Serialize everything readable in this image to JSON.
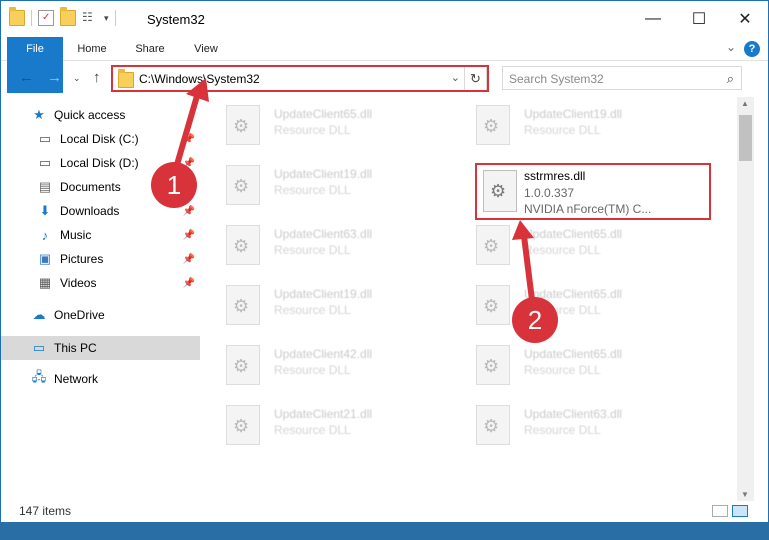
{
  "window": {
    "title": "System32"
  },
  "ribbon": {
    "tabs": [
      "File",
      "Home",
      "Share",
      "View"
    ],
    "help": "?"
  },
  "address": {
    "path": "C:\\Windows\\System32"
  },
  "search": {
    "placeholder": "Search System32"
  },
  "sidebar": {
    "items": [
      {
        "label": "Quick access",
        "icon": "star-icon"
      },
      {
        "label": "Local Disk (C:)",
        "icon": "drive-icon"
      },
      {
        "label": "Local Disk (D:)",
        "icon": "drive-icon"
      },
      {
        "label": "Documents",
        "icon": "documents-icon"
      },
      {
        "label": "Downloads",
        "icon": "download-icon"
      },
      {
        "label": "Music",
        "icon": "music-icon"
      },
      {
        "label": "Pictures",
        "icon": "pictures-icon"
      },
      {
        "label": "Videos",
        "icon": "videos-icon"
      },
      {
        "label": "OneDrive",
        "icon": "cloud-icon"
      },
      {
        "label": "This PC",
        "icon": "computer-icon"
      },
      {
        "label": "Network",
        "icon": "network-icon"
      }
    ]
  },
  "files": {
    "left": [
      {
        "name": "UpdateClient65.dll",
        "type": "Resource DLL"
      },
      {
        "name": "UpdateClient19.dll",
        "type": "Resource DLL"
      },
      {
        "name": "UpdateClient63.dll",
        "type": "Resource DLL"
      },
      {
        "name": "UpdateClient19.dll",
        "type": "Resource DLL"
      },
      {
        "name": "UpdateClient42.dll",
        "type": "Resource DLL"
      },
      {
        "name": "UpdateClient21.dll",
        "type": "Resource DLL"
      }
    ],
    "right": [
      {
        "name": "UpdateClient19.dll",
        "type": "Resource DLL"
      },
      {
        "name": "UpdateClient65.dll",
        "type": "Resource DLL"
      },
      {
        "name": "UpdateClient65.dll",
        "type": "Resource DLL"
      },
      {
        "name": "UpdateClient65.dll",
        "type": "Resource DLL"
      },
      {
        "name": "UpdateClient63.dll",
        "type": "Resource DLL"
      }
    ],
    "highlighted": {
      "name": "sstrmres.dll",
      "version": "1.0.0.337",
      "description": "NVIDIA nForce(TM) C..."
    }
  },
  "status": {
    "count": "147 items"
  },
  "annotations": {
    "badge1": "1",
    "badge2": "2",
    "color": "#d8323a"
  }
}
